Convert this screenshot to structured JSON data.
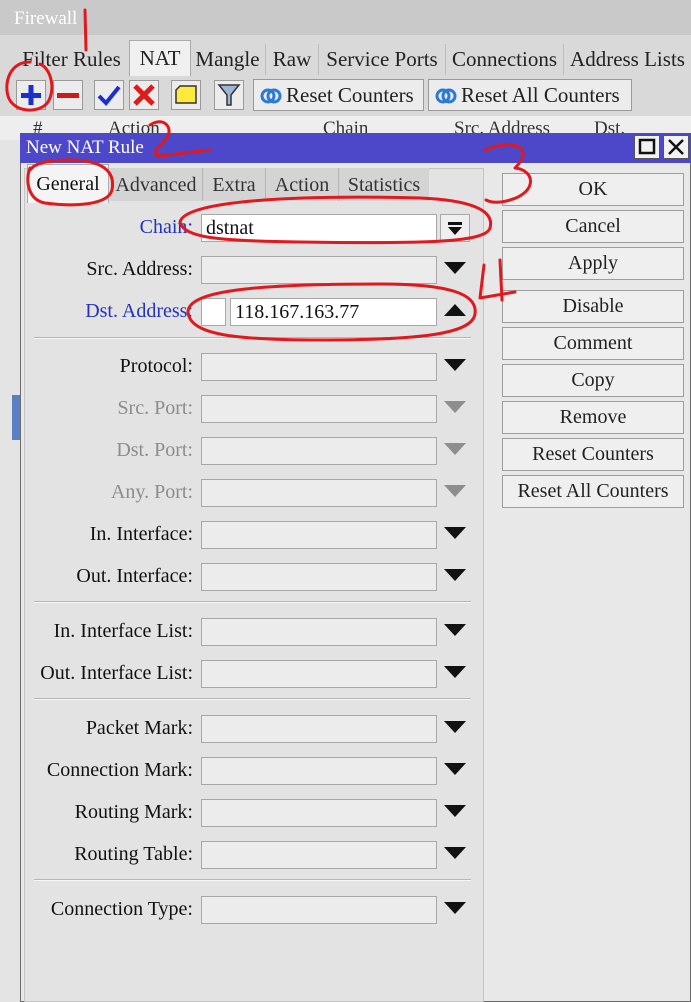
{
  "firewall": {
    "title": "Firewall",
    "tabs": [
      "Filter Rules",
      "NAT",
      "Mangle",
      "Raw",
      "Service Ports",
      "Connections",
      "Address Lists"
    ],
    "active_tab": "NAT",
    "toolbar": {
      "reset_counters": "Reset Counters",
      "reset_all_counters": "Reset All Counters"
    },
    "table_headers": [
      "#",
      "Action",
      "Chain",
      "Src. Address",
      "Dst. Address"
    ]
  },
  "dialog": {
    "title": "New NAT Rule",
    "tabs": [
      "General",
      "Advanced",
      "Extra",
      "Action",
      "Statistics"
    ],
    "active_tab": "General",
    "fields": {
      "chain": {
        "label": "Chain:",
        "value": "dstnat"
      },
      "src_address": {
        "label": "Src. Address:",
        "value": ""
      },
      "dst_address": {
        "label": "Dst. Address:",
        "value": "118.167.163.77"
      },
      "protocol": {
        "label": "Protocol:",
        "value": ""
      },
      "src_port": {
        "label": "Src. Port:",
        "value": ""
      },
      "dst_port": {
        "label": "Dst. Port:",
        "value": ""
      },
      "any_port": {
        "label": "Any. Port:",
        "value": ""
      },
      "in_interface": {
        "label": "In. Interface:",
        "value": ""
      },
      "out_interface": {
        "label": "Out. Interface:",
        "value": ""
      },
      "in_interface_list": {
        "label": "In. Interface List:",
        "value": ""
      },
      "out_interface_list": {
        "label": "Out. Interface List:",
        "value": ""
      },
      "packet_mark": {
        "label": "Packet Mark:",
        "value": ""
      },
      "connection_mark": {
        "label": "Connection Mark:",
        "value": ""
      },
      "routing_mark": {
        "label": "Routing Mark:",
        "value": ""
      },
      "routing_table": {
        "label": "Routing Table:",
        "value": ""
      },
      "connection_type": {
        "label": "Connection Type:",
        "value": ""
      }
    },
    "buttons": [
      "OK",
      "Cancel",
      "Apply",
      "Disable",
      "Comment",
      "Copy",
      "Remove",
      "Reset Counters",
      "Reset All Counters"
    ]
  },
  "annotations": {
    "marks": [
      "1",
      "2",
      "3",
      "4"
    ]
  },
  "colors": {
    "title_bar": "#4c48c9",
    "accent_blue": "#2233c0",
    "annotation_red": "#e0191f"
  }
}
